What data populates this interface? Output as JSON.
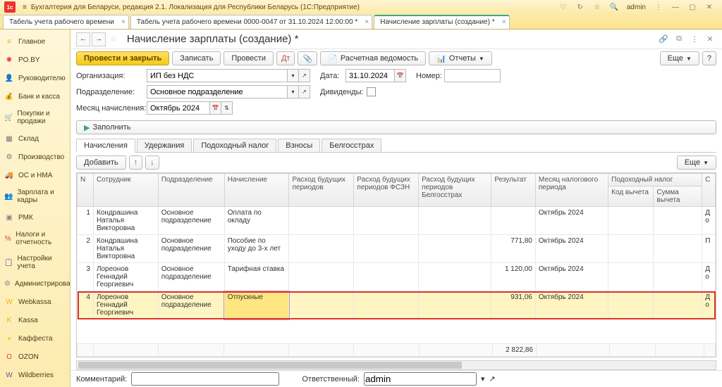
{
  "app": {
    "title": "Бухгалтерия для Беларуси, редакция 2.1. Локализация для Республики Беларусь  (1С:Предприятие)",
    "user": "admin"
  },
  "docTabs": [
    {
      "label": "Табель учета рабочего времени",
      "active": false
    },
    {
      "label": "Табель учета рабочего времени 0000-0047 от 31.10.2024 12:00:00 *",
      "active": false
    },
    {
      "label": "Начисление зарплаты (создание) *",
      "active": true
    }
  ],
  "sidebar": {
    "items": [
      {
        "label": "Главное",
        "icon": "≡",
        "color": "#e6b800"
      },
      {
        "label": "PO.BY",
        "icon": "✱",
        "color": "#e34"
      },
      {
        "label": "Руководителю",
        "icon": "👤",
        "color": "#c77"
      },
      {
        "label": "Банк и касса",
        "icon": "💰",
        "color": "#3a7"
      },
      {
        "label": "Покупки и продажи",
        "icon": "🛒",
        "color": "#a55"
      },
      {
        "label": "Склад",
        "icon": "▦",
        "color": "#777"
      },
      {
        "label": "Производство",
        "icon": "⚙",
        "color": "#777"
      },
      {
        "label": "ОС и НМА",
        "icon": "🚚",
        "color": "#888"
      },
      {
        "label": "Зарплата и кадры",
        "icon": "👥",
        "color": "#c44"
      },
      {
        "label": "РМК",
        "icon": "▣",
        "color": "#888"
      },
      {
        "label": "Налоги и отчетность",
        "icon": "%",
        "color": "#c44"
      },
      {
        "label": "Настройки учета",
        "icon": "📋",
        "color": "#888"
      },
      {
        "label": "Администрирование",
        "icon": "⚙",
        "color": "#888"
      },
      {
        "label": "Webkassa",
        "icon": "W",
        "color": "#e6b800"
      },
      {
        "label": "Kassa",
        "icon": "K",
        "color": "#e6b800"
      },
      {
        "label": "Каффеста",
        "icon": "●",
        "color": "#f3d24b"
      },
      {
        "label": "OZON",
        "icon": "O",
        "color": "#e34"
      },
      {
        "label": "Wildberries",
        "icon": "W",
        "color": "#8a3fa0"
      }
    ]
  },
  "page": {
    "title": "Начисление зарплаты (создание) *",
    "toolbar": {
      "post_close": "Провести и закрыть",
      "save": "Записать",
      "post": "Провести",
      "payslip": "Расчетная ведомость",
      "reports": "Отчеты",
      "more": "Еще",
      "help": "?"
    },
    "form": {
      "org_label": "Организация:",
      "org_value": "ИП без НДС",
      "date_label": "Дата:",
      "date_value": "31.10.2024",
      "number_label": "Номер:",
      "number_value": "",
      "dept_label": "Подразделение:",
      "dept_value": "Основное подразделение",
      "dividends_label": "Дивиденды:",
      "month_label": "Месяц начисления:",
      "month_value": "Октябрь 2024",
      "fill": "Заполнить"
    },
    "innerTabs": [
      {
        "label": "Начисления",
        "active": true
      },
      {
        "label": "Удержания",
        "active": false
      },
      {
        "label": "Подоходный налог",
        "active": false
      },
      {
        "label": "Взносы",
        "active": false
      },
      {
        "label": "Белгосстрах",
        "active": false
      }
    ],
    "gridToolbar": {
      "add": "Добавить",
      "more": "Еще"
    },
    "columns": {
      "n": "N",
      "emp": "Сотрудник",
      "dept": "Подразделение",
      "accrual": "Начисление",
      "exp1": "Расход будущих периодов",
      "exp2": "Расход будущих периодов ФСЗН",
      "exp3": "Расход будущих периодов Белгосстрах",
      "result": "Результат",
      "taxmonth": "Месяц налогового периода",
      "pit": "Подоходный налог",
      "dedcode": "Код вычета",
      "dedsum": "Сумма вычета",
      "s": "С"
    },
    "rows": [
      {
        "n": 1,
        "emp": "Кондрашина Наталья Викторовна",
        "dept": "Основное подразделение",
        "accrual": "Оплата по окладу",
        "result": "",
        "taxmonth": "Октябрь 2024",
        "pit": "Д о"
      },
      {
        "n": 2,
        "emp": "Кондрашина Наталья Викторовна",
        "dept": "Основное подразделение",
        "accrual": "Пособие по уходу до 3-х лет",
        "result": "771,80",
        "taxmonth": "Октябрь 2024",
        "pit": "П"
      },
      {
        "n": 3,
        "emp": "Лореонов Геннадий Георгиевич",
        "dept": "Основное подразделение",
        "accrual": "Тарифная ставка",
        "result": "1 120,00",
        "taxmonth": "Октябрь 2024",
        "pit": "Д о"
      },
      {
        "n": 4,
        "emp": "Лореонов Геннадий Георгиевич",
        "dept": "Основное подразделение",
        "accrual": "Отпускные",
        "result": "931,06",
        "taxmonth": "Октябрь 2024",
        "pit": "Д о",
        "selected": true
      }
    ],
    "total": "2 822,86",
    "footer": {
      "comment_label": "Комментарий:",
      "comment_value": "",
      "resp_label": "Ответственный:",
      "resp_value": "admin"
    }
  }
}
